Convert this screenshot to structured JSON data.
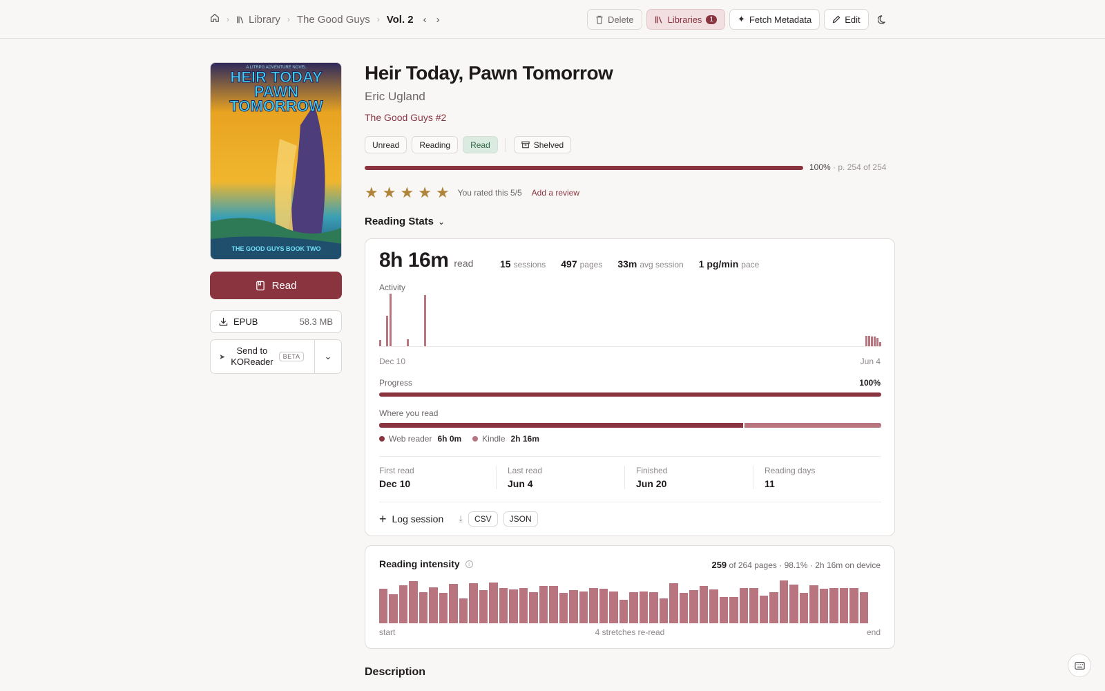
{
  "breadcrumb": {
    "library": "Library",
    "series": "The Good Guys",
    "current": "Vol. 2"
  },
  "toolbar": {
    "delete_label": "Delete",
    "libraries_label": "Libraries",
    "libraries_count": "1",
    "fetch_label": "Fetch Metadata",
    "edit_label": "Edit"
  },
  "book": {
    "title": "Heir Today, Pawn Tomorrow",
    "author": "Eric Ugland",
    "series": "The Good Guys #2",
    "cover_top_text": "A LITRPG ADVENTURE NOVEL",
    "cover_title_lines": [
      "HEIR TODAY",
      "PAWN",
      "TOMORROW"
    ],
    "cover_bottom_text": "THE GOOD GUYS BOOK TWO"
  },
  "actions": {
    "read_label": "Read",
    "format": "EPUB",
    "size": "58.3 MB",
    "send_line1": "Send to",
    "send_line2": "KOReader",
    "beta": "BETA"
  },
  "status": {
    "chips": [
      "Unread",
      "Reading",
      "Read"
    ],
    "selected": "Read",
    "shelved": "Shelved"
  },
  "progress": {
    "percent_text": "100%",
    "pages_text": "· p. 254 of 254",
    "fraction": 1.0
  },
  "rating": {
    "stars": 5,
    "max": 5,
    "text": "You rated this 5/5",
    "review_link": "Add a review"
  },
  "stats": {
    "heading": "Reading Stats",
    "total_time": "8h 16m",
    "total_time_unit": "read",
    "sessions": "15",
    "sessions_unit": "sessions",
    "pages": "497",
    "pages_unit": "pages",
    "avg": "33m",
    "avg_unit": "avg session",
    "pace": "1 pg/min",
    "pace_unit": "pace",
    "activity_label": "Activity",
    "activity_start": "Dec 10",
    "activity_end": "Jun 4",
    "activity_values": [
      0.12,
      0,
      0.58,
      1.0,
      0,
      0,
      0,
      0,
      0.13,
      0,
      0,
      0,
      0,
      0.97
    ],
    "activity_end_values": [
      0.2,
      0.2,
      0.18,
      0.18,
      0.16,
      0.08
    ],
    "progress_label": "Progress",
    "progress_value": "100%",
    "where_label": "Where you read",
    "web_label": "Web reader",
    "web_time": "6h 0m",
    "web_fraction": 0.725,
    "kindle_label": "Kindle",
    "kindle_time": "2h 16m",
    "first_read_label": "First read",
    "first_read": "Dec 10",
    "last_read_label": "Last read",
    "last_read": "Jun 4",
    "finished_label": "Finished",
    "finished": "Jun 20",
    "days_label": "Reading days",
    "days": "11",
    "log_label": "Log session",
    "csv": "CSV",
    "json": "JSON"
  },
  "intensity": {
    "heading": "Reading intensity",
    "pages_read": "259",
    "summary": "of 264 pages · 98.1% · 2h 16m on device",
    "start": "start",
    "middle": "4 stretches re-read",
    "end": "end",
    "values": [
      0.78,
      0.66,
      0.86,
      0.95,
      0.71,
      0.82,
      0.68,
      0.89,
      0.56,
      0.9,
      0.75,
      0.92,
      0.8,
      0.76,
      0.8,
      0.7,
      0.85,
      0.84,
      0.68,
      0.75,
      0.72,
      0.8,
      0.78,
      0.72,
      0.53,
      0.7,
      0.72,
      0.7,
      0.56,
      0.9,
      0.68,
      0.75,
      0.85,
      0.77,
      0.6,
      0.6,
      0.8,
      0.8,
      0.62,
      0.7,
      0.97,
      0.88,
      0.68,
      0.86,
      0.78,
      0.8,
      0.8,
      0.8,
      0.7
    ]
  },
  "description_heading": "Description"
}
